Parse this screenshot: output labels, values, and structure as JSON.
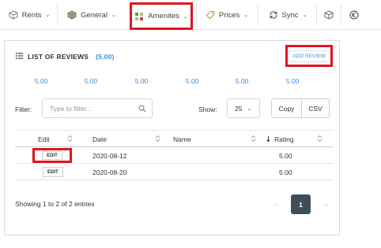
{
  "nav": {
    "items": [
      {
        "label": "Rents",
        "icon": "cube-icon"
      },
      {
        "label": "General",
        "icon": "box-icon"
      },
      {
        "label": "Amenites",
        "icon": "amenities-icon"
      },
      {
        "label": "Prices",
        "icon": "tag-icon"
      },
      {
        "label": "Sync",
        "icon": "sync-icon"
      }
    ],
    "extra_icons": [
      "box-icon",
      "copyright-icon"
    ]
  },
  "reviews": {
    "title": "LIST OF REVIEWS",
    "count": "(5.00)",
    "add_button": "ADD REVIEW",
    "stats": [
      "5.00",
      "5.00",
      "5.00",
      "5.00",
      "5.00",
      "5.00"
    ]
  },
  "controls": {
    "filter_label": "Filter:",
    "filter_placeholder": "Type to filter...",
    "show_label": "Show:",
    "show_value": "25",
    "copy_label": "Copy",
    "csv_label": "CSV"
  },
  "table": {
    "columns": [
      "Edit",
      "Date",
      "Name",
      "Rating"
    ],
    "rows": [
      {
        "edit": "EDIT",
        "date": "2020-08-12",
        "name": "",
        "rating": "5.00"
      },
      {
        "edit": "EDIT",
        "date": "2020-08-20",
        "name": "",
        "rating": "5.00"
      }
    ]
  },
  "footer": {
    "showing": "Showing 1 to 2 of 2 entries",
    "prev": "←",
    "page": "1",
    "next": "→"
  },
  "colors": {
    "accent": "#3a8fd9",
    "highlight": "#e0151f",
    "pager": "#3f4f5a"
  }
}
